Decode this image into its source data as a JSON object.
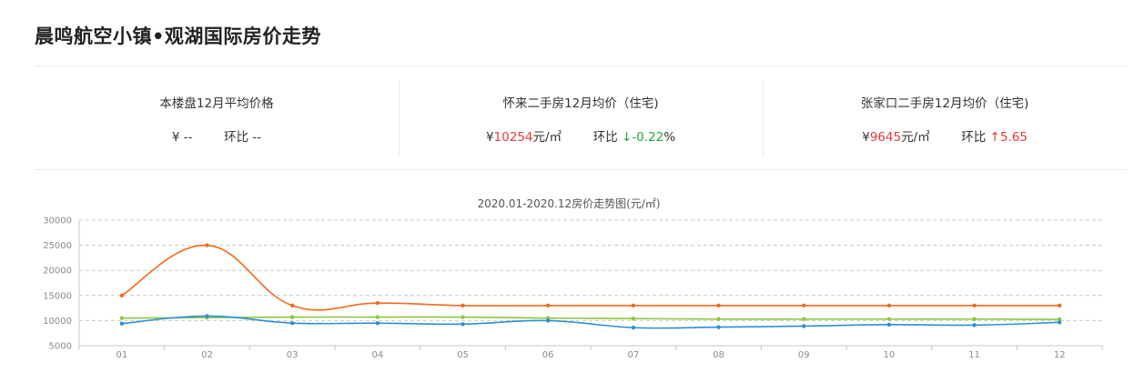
{
  "page": {
    "title": "晨鸣航空小镇•观湖国际房价走势"
  },
  "stats": [
    {
      "title": "本楼盘12月平均价格",
      "price_prefix": "¥",
      "price": "--",
      "unit": "",
      "ratio_label": "环比",
      "arrow": "",
      "change": "--",
      "suffix": "",
      "color": ""
    },
    {
      "title": "怀来二手房12月均价（住宅)",
      "price_prefix": "¥",
      "price": "10254",
      "unit": "元/㎡",
      "ratio_label": "环比",
      "arrow": "↓",
      "change": "-0.22",
      "suffix": "%",
      "color": "green"
    },
    {
      "title": "张家口二手房12月均价（住宅)",
      "price_prefix": "¥",
      "price": "9645",
      "unit": "元/㎡",
      "ratio_label": "环比",
      "arrow": "↑",
      "change": "5.65",
      "suffix": "",
      "color": "red"
    }
  ],
  "chart_data": {
    "type": "line",
    "title": "2020.01-2020.12房价走势图(元/㎡)",
    "categories": [
      "01",
      "02",
      "03",
      "04",
      "05",
      "06",
      "07",
      "08",
      "09",
      "10",
      "11",
      "12"
    ],
    "ylim": [
      5000,
      30000
    ],
    "yticks": [
      5000,
      10000,
      15000,
      20000,
      25000,
      30000
    ],
    "grid": true,
    "series": [
      {
        "color": "#f26a1b",
        "values": [
          15000,
          25000,
          13000,
          13500,
          13000,
          13000,
          13000,
          13000,
          13000,
          13000,
          13000,
          13000
        ]
      },
      {
        "color": "#8cc63f",
        "values": [
          10500,
          10600,
          10700,
          10700,
          10700,
          10500,
          10400,
          10300,
          10300,
          10300,
          10300,
          10254
        ]
      },
      {
        "color": "#2b8fd9",
        "values": [
          9400,
          10900,
          9500,
          9500,
          9300,
          10000,
          8600,
          8700,
          8900,
          9200,
          9100,
          9645
        ]
      }
    ]
  }
}
